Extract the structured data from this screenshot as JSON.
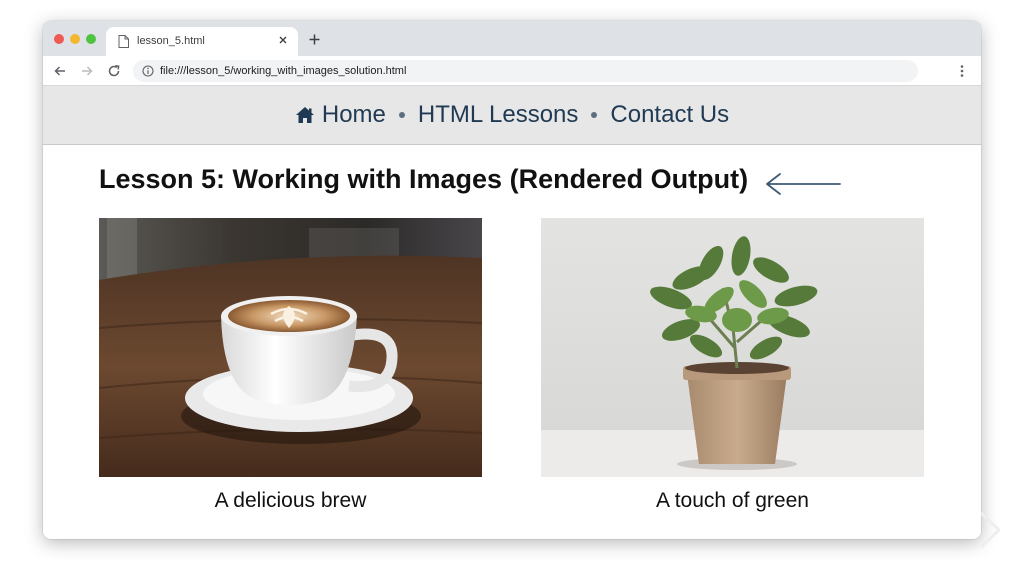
{
  "browser": {
    "tab_title": "lesson_5.html",
    "url": "file:///lesson_5/working_with_images_solution.html"
  },
  "site_nav": {
    "items": [
      {
        "label": "Home",
        "icon": "house-icon"
      },
      {
        "label": "HTML Lessons"
      },
      {
        "label": "Contact Us"
      }
    ]
  },
  "page": {
    "title": "Lesson 5: Working with Images (Rendered Output)",
    "figures": [
      {
        "caption": "A delicious brew",
        "image": "latte-cup-photo"
      },
      {
        "caption": "A touch of green",
        "image": "potted-plant-photo"
      }
    ]
  },
  "colors": {
    "nav_text": "#1f3a52",
    "nav_background": "#e7e7e7",
    "arrow": "#3f5a75",
    "tabstrip": "#dee1e6"
  }
}
